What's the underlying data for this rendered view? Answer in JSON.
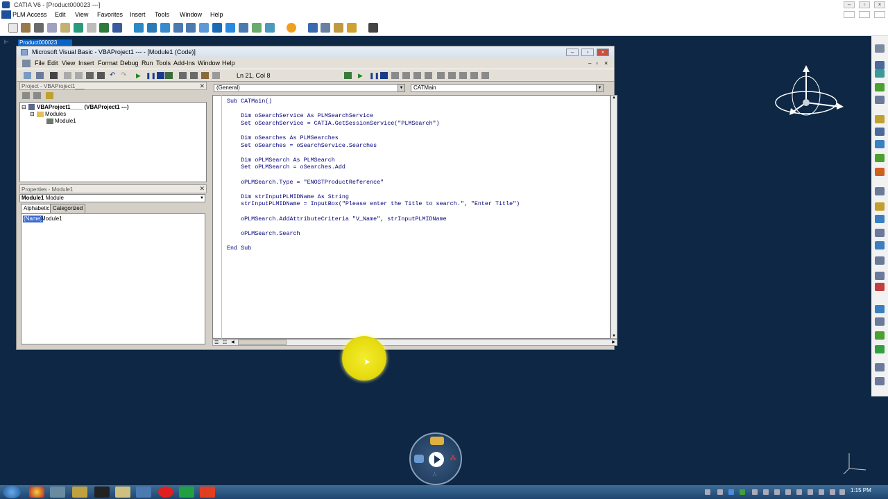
{
  "catia": {
    "title": "CATIA V6 - [Product000023 ---]",
    "menu": [
      "PLM Access",
      "Edit",
      "View",
      "Favorites",
      "Insert",
      "Tools",
      "Window",
      "Help"
    ],
    "spec_tab": "Product000023"
  },
  "vba": {
    "title": "Microsoft Visual Basic - VBAProject1 --- - [Module1 (Code)]",
    "menu": [
      "File",
      "Edit",
      "View",
      "Insert",
      "Format",
      "Debug",
      "Run",
      "Tools",
      "Add-Ins",
      "Window",
      "Help"
    ],
    "cursor_position": "Ln 21, Col 8",
    "project": {
      "header": "Project - VBAProject1___",
      "root": "VBAProject1____ (VBAProject1 ---)",
      "folder": "Modules",
      "module": "Module1"
    },
    "properties": {
      "header": "Properties - Module1",
      "object_bold": "Module1",
      "object_type": "Module",
      "tabs": [
        "Alphabetic",
        "Categorized"
      ],
      "row_name": "(Name)",
      "row_value": "Module1"
    },
    "code_combo_left": "(General)",
    "code_combo_right": "CATMain",
    "code": "Sub CATMain()\n\n    Dim oSearchService As PLMSearchService\n    Set oSearchService = CATIA.GetSessionService(\"PLMSearch\")\n\n    Dim oSearches As PLMSearches\n    Set oSearches = oSearchService.Searches\n\n    Dim oPLMSearch As PLMSearch\n    Set oPLMSearch = oSearches.Add\n\n    oPLMSearch.Type = \"ENOSTProductReference\"\n\n    Dim strInputPLMIDName As String\n    strInputPLMIDName = InputBox(\"Please enter the Title to search.\", \"Enter Title\")\n\n    oPLMSearch.AddAttributeCriteria \"V_Name\", strInputPLMIDName\n\n    oPLMSearch.Search\n\nEnd Sub"
  },
  "taskbar": {
    "clock": "1:15 PM"
  },
  "colors": {
    "background": "#0d2744",
    "cursor_highlight": "#e6dc10"
  }
}
